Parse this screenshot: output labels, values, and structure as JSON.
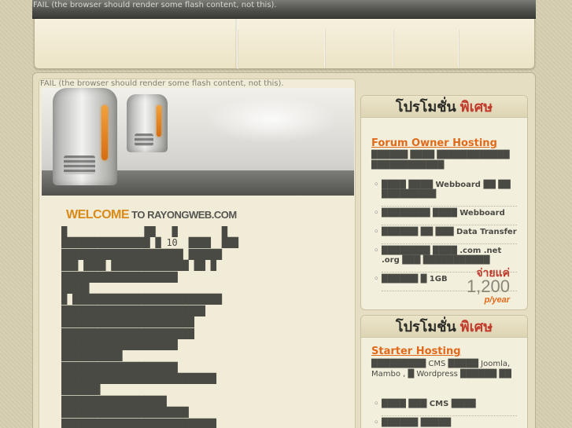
{
  "flash_fallback": "FAIL (the browser should render some flash content, not this).",
  "colors": {
    "accent": "#e06a1a",
    "promo_red": "#c0392b",
    "welcome_orange": "#d98a18",
    "background": "#d7cfb2"
  },
  "welcome": {
    "highlight": "WELCOME",
    "rest": " TO RAYONGWEB.COM"
  },
  "body_lines": [
    "█              ██   █        █",
    "████████████████ █ 10  ████  ███",
    "██████████████████████ ██████",
    "███ ████ ██████████████ ██ █",
    "█████████████████████",
    "█████",
    "█ ███████████████████████████",
    "██████████████████████████",
    "████████████████████████",
    "████████████████████████",
    "█████████████████████",
    "███████████",
    "█████████████████████",
    "████████████████████████████",
    "███████",
    "███████████████████",
    "███████████████████████",
    "████████████████████████████",
    "███████ ███  ███████████"
  ],
  "promos": [
    {
      "heading_dark": "โปรโมชั่น ",
      "heading_red": "พิเศษ",
      "title": "Forum Owner Hosting ",
      "desc": "██████ ████ ████████████ ████████████",
      "items": [
        "████ ████ Webboard ██ ██ █████████",
        "████████ ████ Webboard",
        "██████ ██ ███ Data Transfer",
        "████████ ████ .com .net .org ███ ███████████",
        "██████ █ 1GB"
      ],
      "price_label": "จ่ายแค่",
      "price_value": "1,200",
      "price_unit": "p/year"
    },
    {
      "heading_dark": "โปรโมชั่น ",
      "heading_red": "พิเศษ",
      "title": "Starter Hosting ",
      "desc": "█████████ CMS █████ Joomla, Mambo , █ Wordpress ██████ ██",
      "items": [
        "████ ███ CMS ████",
        "██████ █████"
      ]
    }
  ]
}
